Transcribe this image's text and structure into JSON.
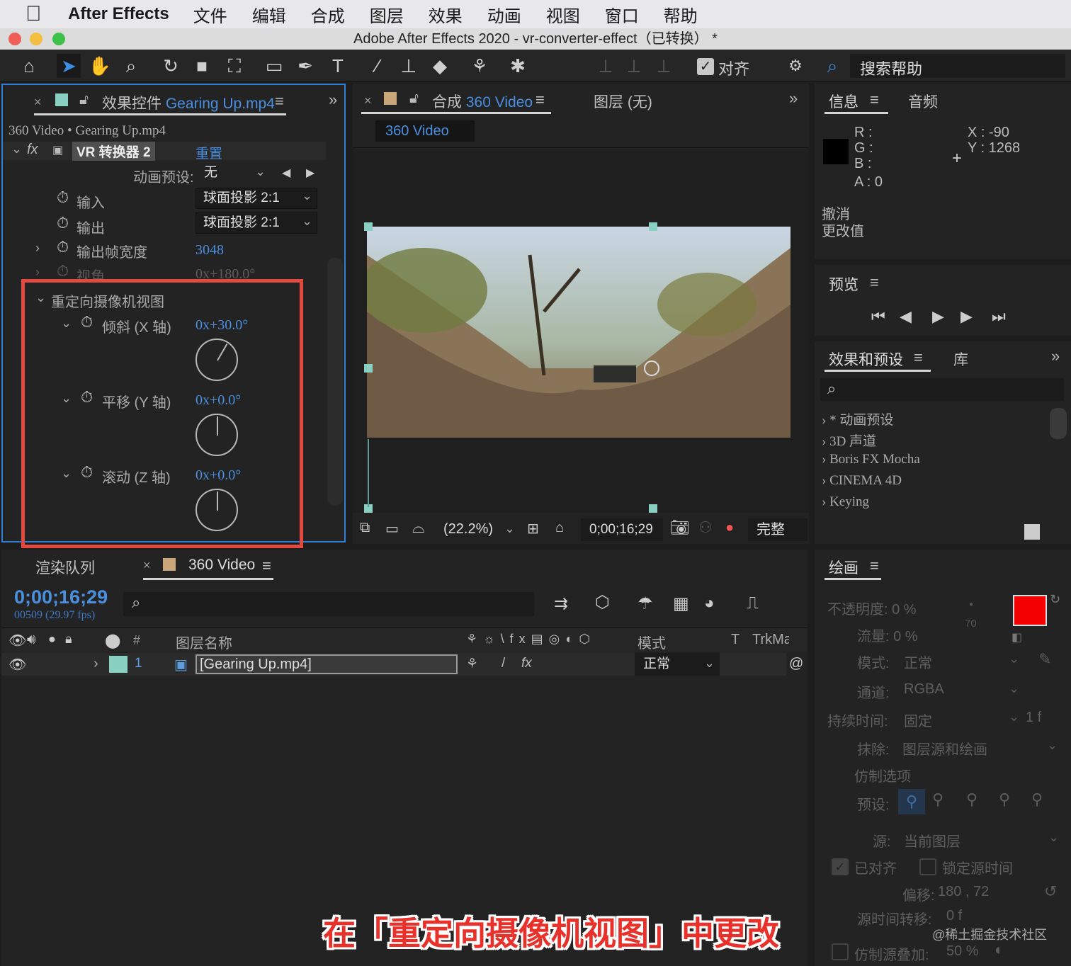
{
  "menubar": {
    "app": "After Effects",
    "items": [
      "文件",
      "编辑",
      "合成",
      "图层",
      "效果",
      "动画",
      "视图",
      "窗口",
      "帮助"
    ]
  },
  "window": {
    "title": "Adobe After Effects 2020 - vr-converter-effect（已转换） *"
  },
  "toolbar": {
    "align_label": "对齐",
    "search_help": "搜索帮助"
  },
  "effects_panel": {
    "tab": "效果控件",
    "tab_file": "Gearing Up.mp4",
    "subtitle": "360 Video • Gearing Up.mp4",
    "effect_name": "VR 转换器 2",
    "reset": "重置",
    "preset_label": "动画预设:",
    "preset_value": "无",
    "input_label": "输入",
    "input_value": "球面投影 2:1",
    "output_label": "输出",
    "output_value": "球面投影 2:1",
    "frame_width_label": "输出帧宽度",
    "frame_width_value": "3048",
    "fov_label": "视角",
    "fov_value": "0x+180.0°",
    "reorient_label": "重定向摄像机视图",
    "tilt_label": "倾斜 (X 轴)",
    "tilt_value": "0x+30.0°",
    "pan_label": "平移 (Y 轴)",
    "pan_value": "0x+0.0°",
    "roll_label": "滚动 (Z 轴)",
    "roll_value": "0x+0.0°"
  },
  "comp_panel": {
    "tab": "合成",
    "tab_comp": "360 Video",
    "layer_tab": "图层 (无)",
    "chip": "360 Video",
    "zoom": "(22.2%)",
    "timecode": "0;00;16;29",
    "quality": "完整"
  },
  "info_panel": {
    "tab": "信息",
    "tab2": "音频",
    "r": "R :",
    "g": "G :",
    "b": "B :",
    "a": "A :  0",
    "x": "X : -90",
    "y": "Y :  1268",
    "undo": "撤消",
    "undo2": "更改值"
  },
  "preview_panel": {
    "tab": "预览"
  },
  "presets_panel": {
    "tab": "效果和预设",
    "tab2": "库",
    "items": [
      "* 动画预设",
      "3D 声道",
      "Boris FX Mocha",
      "CINEMA 4D",
      "Keying"
    ]
  },
  "timeline": {
    "tab_render": "渲染队列",
    "tab_comp": "360 Video",
    "timecode": "0;00;16;29",
    "frames": "00509 (29.97 fps)",
    "col_name": "图层名称",
    "col_mode": "模式",
    "col_t": "T",
    "col_trk": "TrkMat",
    "layer_num": "1",
    "layer_name": "[Gearing Up.mp4]",
    "layer_mode": "正常",
    "col_hash": "#"
  },
  "paint_panel": {
    "tab": "绘画",
    "opacity": "不透明度: 0 %",
    "flow": "流量: 0 %",
    "size": "70",
    "mode_label": "模式:",
    "mode_value": "正常",
    "channel_label": "通道:",
    "channel_value": "RGBA",
    "duration_label": "持续时间:",
    "duration_value": "固定",
    "duration_extra": "1  f",
    "erase_label": "抹除:",
    "erase_value": "图层源和绘画",
    "clone_options": "仿制选项",
    "preset_label": "预设:",
    "source_label": "源:",
    "source_value": "当前图层",
    "aligned": "已对齐",
    "lock_time": "锁定源时间",
    "offset_label": "偏移:",
    "offset_value": "180 ,     72",
    "shift_label": "源时间转移:",
    "shift_value": "0  f",
    "overlay": "仿制源叠加:",
    "overlay_value": "50 %"
  },
  "caption": "在「重定向摄像机视图」中更改",
  "watermark": "@稀土掘金技术社区",
  "colors": {
    "accent_blue": "#4a8fe0",
    "highlight_red": "#e24a3f",
    "caption_red": "#e8312a"
  }
}
